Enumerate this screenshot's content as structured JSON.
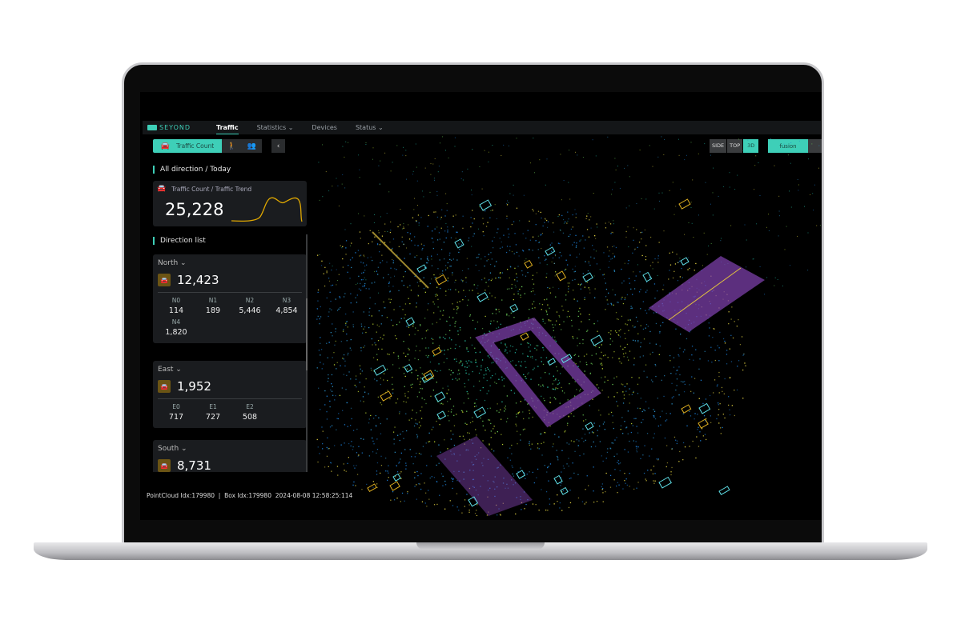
{
  "app": {
    "logo": "SEYOND"
  },
  "nav": {
    "tabs": [
      {
        "label": "Traffic",
        "active": true
      },
      {
        "label": "Statistics ⌄"
      },
      {
        "label": "Devices"
      },
      {
        "label": "Status ⌄"
      }
    ]
  },
  "modebar": {
    "traffic_count": "Traffic Count",
    "icons": [
      "car-icon",
      "pedestrian-icon",
      "group-icon"
    ],
    "back": "‹"
  },
  "views": {
    "side": "SIDE",
    "top": "TOP",
    "d3": "3D",
    "active": "3D",
    "fusion": "fusion"
  },
  "summary": {
    "title": "All direction / Today",
    "card_title": "Traffic Count / Traffic Trend",
    "total": "25,228"
  },
  "direction_list": {
    "title": "Direction list",
    "items": [
      {
        "name": "North ⌄",
        "total": "12,423",
        "lanes": [
          {
            "l": "N0",
            "v": "114"
          },
          {
            "l": "N1",
            "v": "189"
          },
          {
            "l": "N2",
            "v": "5,446"
          },
          {
            "l": "N3",
            "v": "4,854"
          },
          {
            "l": "N4",
            "v": "1,820"
          }
        ]
      },
      {
        "name": "East ⌄",
        "total": "1,952",
        "lanes": [
          {
            "l": "E0",
            "v": "717"
          },
          {
            "l": "E1",
            "v": "727"
          },
          {
            "l": "E2",
            "v": "508"
          }
        ]
      },
      {
        "name": "South ⌄",
        "total": "8,731",
        "lanes": []
      }
    ]
  },
  "status": {
    "pointcloud": "PointCloud Idx:179980",
    "box": "Box Idx:179980",
    "timestamp": "2024-08-08 12:58:25:114"
  },
  "colors": {
    "accent": "#3ecfb8",
    "car": "#f0b400",
    "road": "#7b3fa8",
    "box": "#5fe0e8"
  }
}
